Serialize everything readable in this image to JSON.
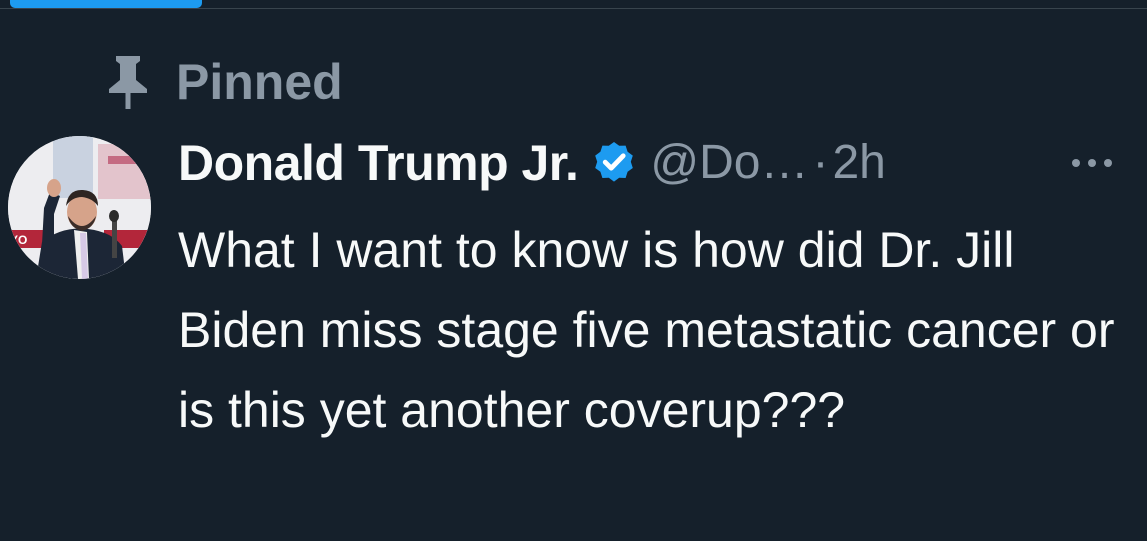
{
  "pinned": {
    "icon": "pin-icon",
    "label": "Pinned"
  },
  "tweet": {
    "author": {
      "display_name": "Donald Trump Jr.",
      "verified_icon": "verified-badge-icon",
      "handle": "@Do…",
      "separator": "·",
      "timestamp": "2h"
    },
    "more_icon": "more-options-icon",
    "text": "What I want to know is how did Dr. Jill Biden miss stage five metastatic cancer or is this yet another coverup???"
  },
  "colors": {
    "background": "#15202b",
    "text_primary": "#f7f9f9",
    "text_secondary": "#8b98a5",
    "accent": "#1d9bf0"
  }
}
